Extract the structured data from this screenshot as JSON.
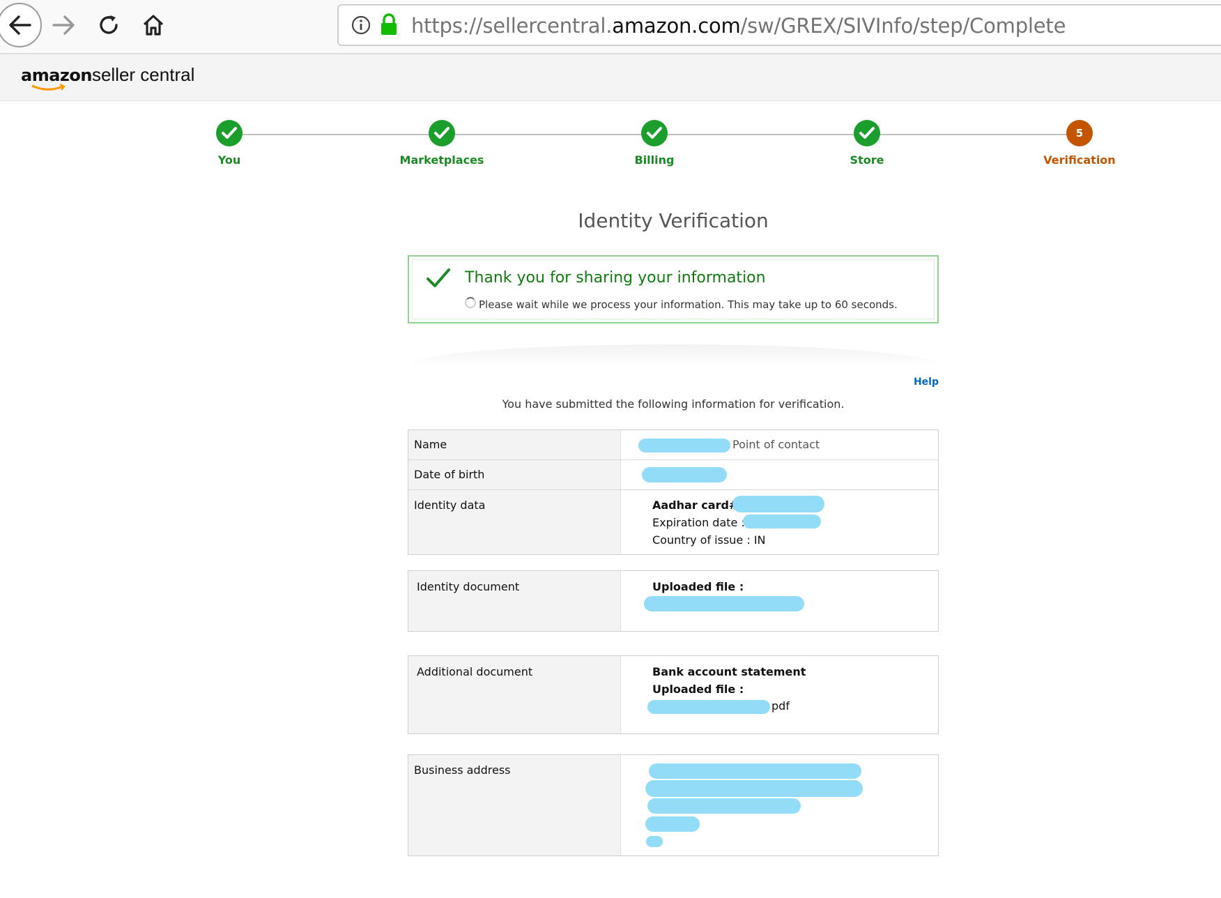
{
  "browser": {
    "url_prefix": "https://sellercentral.",
    "url_domain": "amazon.com",
    "url_path": "/sw/GREX/SIVInfo/step/Complete"
  },
  "header": {
    "logo_amazon": "amazon",
    "logo_seller_central": "seller central"
  },
  "steps": [
    {
      "label": "You",
      "state": "done"
    },
    {
      "label": "Marketplaces",
      "state": "done"
    },
    {
      "label": "Billing",
      "state": "done"
    },
    {
      "label": "Store",
      "state": "done"
    },
    {
      "label": "Verification",
      "state": "current",
      "number": "5"
    }
  ],
  "main": {
    "title": "Identity Verification",
    "alert_heading": "Thank you for sharing your information",
    "alert_message": "Please wait while we process your information. This may take up to 60 seconds.",
    "help_link": "Help",
    "intro": "You have submitted the following information for verification."
  },
  "table1": {
    "name_label": "Name",
    "name_suffix": "Point of contact",
    "dob_label": "Date of birth",
    "identity_label": "Identity data",
    "aadhar_label": "Aadhar card# :",
    "expiration_label": "Expiration date :",
    "country_label": "Country of issue : IN"
  },
  "table2": {
    "label": "Identity document",
    "uploaded": "Uploaded file :"
  },
  "table3": {
    "label": "Additional document",
    "doc_type": "Bank account statement",
    "uploaded": "Uploaded file :",
    "file_suffix": "pdf"
  },
  "table4": {
    "label": "Business address"
  },
  "colors": {
    "done": "#1b9e2b",
    "current": "#c45500",
    "redaction": "#93dcf7",
    "link": "#0066c0"
  }
}
